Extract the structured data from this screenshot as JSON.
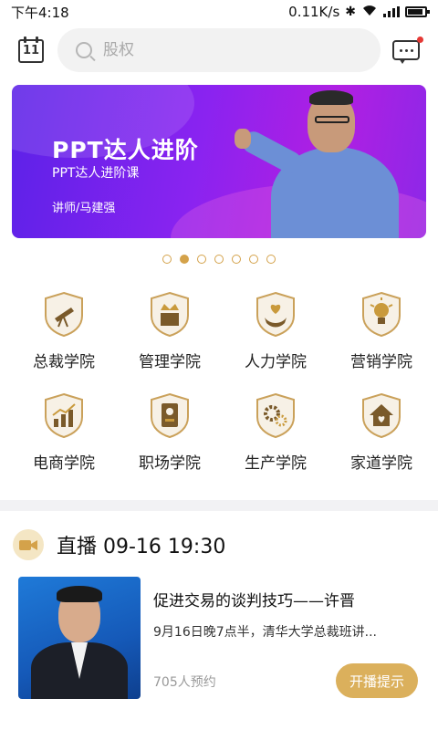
{
  "status_bar": {
    "time": "下午4:18",
    "network_speed": "0.11K/s"
  },
  "header": {
    "calendar_day": "11",
    "search_placeholder": "股权"
  },
  "banner": {
    "title": "PPT达人进阶",
    "subtitle": "PPT达人进阶课",
    "lecturer": "讲师/马建强"
  },
  "carousel": {
    "count": 7,
    "active_index": 1
  },
  "categories": [
    {
      "label": "总裁学院",
      "icon": "telescope-icon"
    },
    {
      "label": "管理学院",
      "icon": "crown-icon"
    },
    {
      "label": "人力学院",
      "icon": "heart-hands-icon"
    },
    {
      "label": "营销学院",
      "icon": "lightbulb-icon"
    },
    {
      "label": "电商学院",
      "icon": "growth-chart-icon"
    },
    {
      "label": "职场学院",
      "icon": "id-badge-icon"
    },
    {
      "label": "生产学院",
      "icon": "gears-icon"
    },
    {
      "label": "家道学院",
      "icon": "house-heart-icon"
    }
  ],
  "live": {
    "heading": "直播 09-16 19:30",
    "course_title": "促进交易的谈判技巧——许晋",
    "description": "9月16日晚7点半，清华大学总裁班讲...",
    "subscribers": "705人预约",
    "remind_label": "开播提示"
  },
  "colors": {
    "accent_gold": "#d4a24a",
    "banner_purple": "#8a23f0"
  }
}
